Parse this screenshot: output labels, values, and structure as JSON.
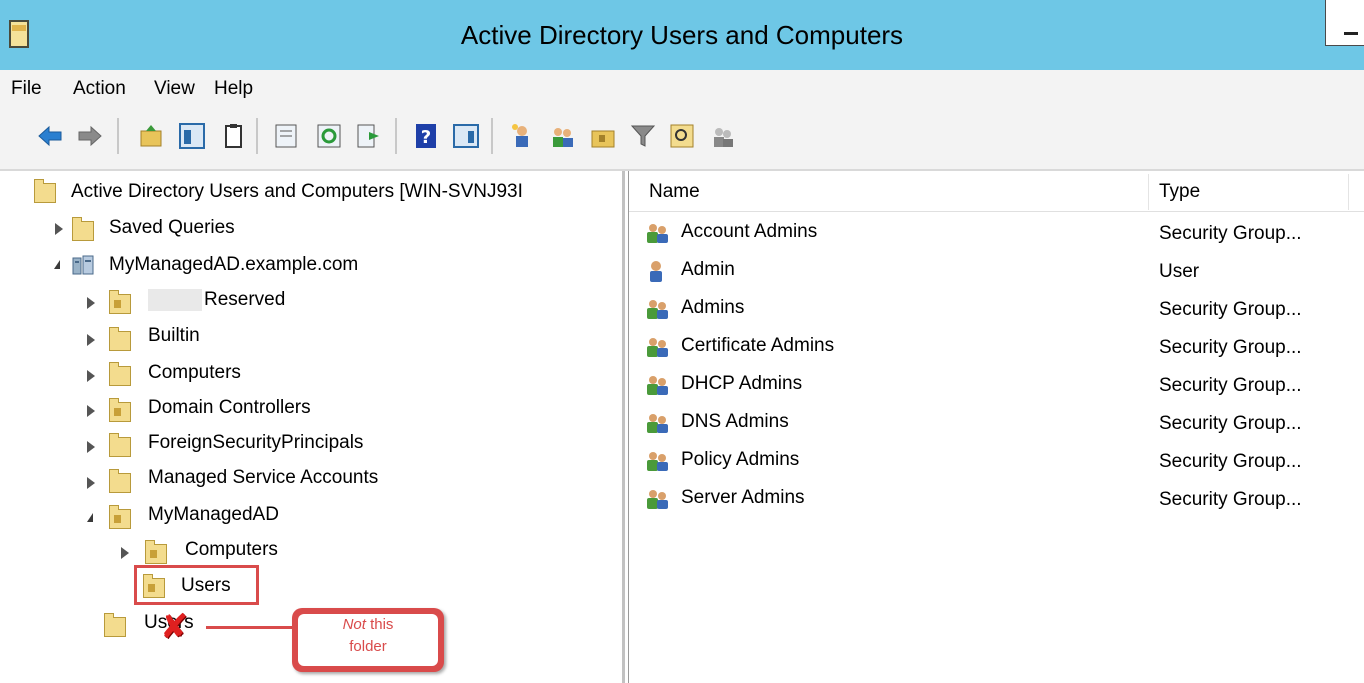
{
  "window": {
    "title": "Active Directory Users and Computers"
  },
  "menu": [
    "File",
    "Action",
    "View",
    "Help"
  ],
  "toolbar": {
    "icons": [
      "back-arrow-icon",
      "forward-arrow-icon",
      "up-folder-icon",
      "show-tree-icon",
      "clipboard-icon",
      "properties-icon",
      "refresh-icon",
      "export-list-icon",
      "help-icon",
      "toggle-pane-icon",
      "new-user-icon",
      "new-group-icon",
      "new-ou-icon",
      "filter-icon",
      "find-icon",
      "add-to-group-icon"
    ]
  },
  "tree": {
    "root": "Active Directory Users and Computers [WIN-SVNJ93I",
    "items": [
      {
        "label": "Saved Queries"
      },
      {
        "label": "MyManagedAD.example.com"
      },
      {
        "label": "Reserved"
      },
      {
        "label": "Builtin"
      },
      {
        "label": "Computers"
      },
      {
        "label": "Domain Controllers"
      },
      {
        "label": "ForeignSecurityPrincipals"
      },
      {
        "label": "Managed Service Accounts"
      },
      {
        "label": "MyManagedAD"
      },
      {
        "label": "Computers"
      },
      {
        "label": "Users"
      },
      {
        "label": "Users"
      }
    ]
  },
  "list": {
    "columns": {
      "name": "Name",
      "type": "Type"
    },
    "rows": [
      {
        "name": "Account Admins",
        "type": "Security Group..."
      },
      {
        "name": "Admin",
        "type": "User"
      },
      {
        "name": "Admins",
        "type": "Security Group..."
      },
      {
        "name": "Certificate Admins",
        "type": "Security Group..."
      },
      {
        "name": "DHCP Admins",
        "type": "Security Group..."
      },
      {
        "name": "DNS Admins",
        "type": "Security Group..."
      },
      {
        "name": "Policy Admins",
        "type": "Security Group..."
      },
      {
        "name": "Server Admins",
        "type": "Security Group..."
      }
    ]
  },
  "callout": {
    "italic": "Not",
    "rest": " this",
    "line2": "folder"
  },
  "colors": {
    "title_bar": "#6ec7e6",
    "highlight": "#d94b4b"
  }
}
